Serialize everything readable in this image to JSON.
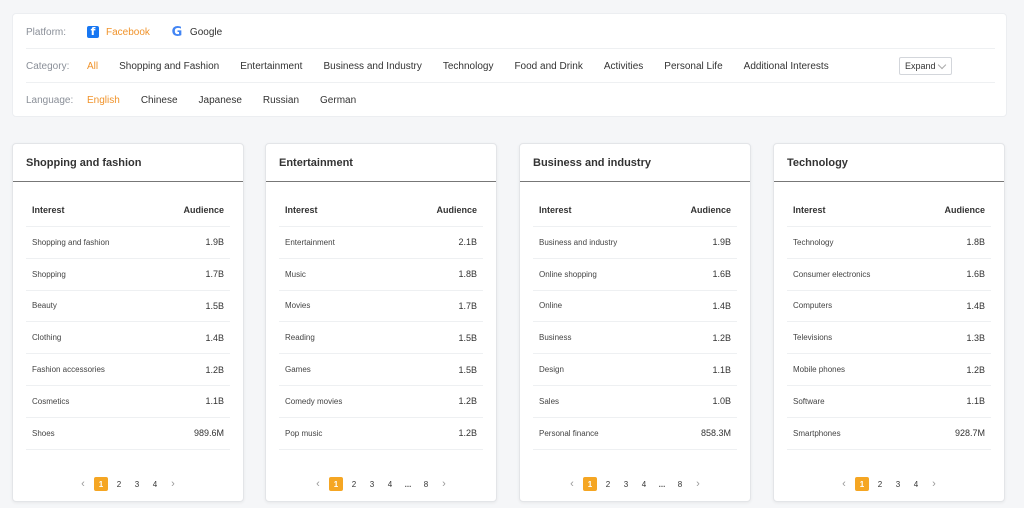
{
  "filters": {
    "platform": {
      "label": "Platform:",
      "options": [
        {
          "label": "Facebook",
          "icon": "facebook-icon",
          "active": true
        },
        {
          "label": "Google",
          "icon": "google-icon",
          "active": false
        }
      ]
    },
    "category": {
      "label": "Category:",
      "options": [
        "All",
        "Shopping and Fashion",
        "Entertainment",
        "Business and Industry",
        "Technology",
        "Food and Drink",
        "Activities",
        "Personal Life",
        "Additional Interests"
      ],
      "active": "All",
      "expand_label": "Expand"
    },
    "language": {
      "label": "Language:",
      "options": [
        "English",
        "Chinese",
        "Japanese",
        "Russian",
        "German"
      ],
      "active": "English"
    }
  },
  "accent_color": "#f0932b",
  "table_headers": {
    "interest": "Interest",
    "audience": "Audience"
  },
  "cards": [
    {
      "title": "Shopping and fashion",
      "rows": [
        {
          "interest": "Shopping and fashion",
          "audience": "1.9B"
        },
        {
          "interest": "Shopping",
          "audience": "1.7B"
        },
        {
          "interest": "Beauty",
          "audience": "1.5B"
        },
        {
          "interest": "Clothing",
          "audience": "1.4B"
        },
        {
          "interest": "Fashion accessories",
          "audience": "1.2B"
        },
        {
          "interest": "Cosmetics",
          "audience": "1.1B"
        },
        {
          "interest": "Shoes",
          "audience": "989.6M"
        }
      ],
      "pages": [
        "1",
        "2",
        "3",
        "4"
      ],
      "current_page": "1"
    },
    {
      "title": "Entertainment",
      "rows": [
        {
          "interest": "Entertainment",
          "audience": "2.1B"
        },
        {
          "interest": "Music",
          "audience": "1.8B"
        },
        {
          "interest": "Movies",
          "audience": "1.7B"
        },
        {
          "interest": "Reading",
          "audience": "1.5B"
        },
        {
          "interest": "Games",
          "audience": "1.5B"
        },
        {
          "interest": "Comedy movies",
          "audience": "1.2B"
        },
        {
          "interest": "Pop music",
          "audience": "1.2B"
        }
      ],
      "pages": [
        "1",
        "2",
        "3",
        "4",
        "...",
        "8"
      ],
      "current_page": "1"
    },
    {
      "title": "Business and industry",
      "rows": [
        {
          "interest": "Business and industry",
          "audience": "1.9B"
        },
        {
          "interest": "Online shopping",
          "audience": "1.6B"
        },
        {
          "interest": "Online",
          "audience": "1.4B"
        },
        {
          "interest": "Business",
          "audience": "1.2B"
        },
        {
          "interest": "Design",
          "audience": "1.1B"
        },
        {
          "interest": "Sales",
          "audience": "1.0B"
        },
        {
          "interest": "Personal finance",
          "audience": "858.3M"
        }
      ],
      "pages": [
        "1",
        "2",
        "3",
        "4",
        "...",
        "8"
      ],
      "current_page": "1"
    },
    {
      "title": "Technology",
      "rows": [
        {
          "interest": "Technology",
          "audience": "1.8B"
        },
        {
          "interest": "Consumer electronics",
          "audience": "1.6B"
        },
        {
          "interest": "Computers",
          "audience": "1.4B"
        },
        {
          "interest": "Televisions",
          "audience": "1.3B"
        },
        {
          "interest": "Mobile phones",
          "audience": "1.2B"
        },
        {
          "interest": "Software",
          "audience": "1.1B"
        },
        {
          "interest": "Smartphones",
          "audience": "928.7M"
        }
      ],
      "pages": [
        "1",
        "2",
        "3",
        "4"
      ],
      "current_page": "1"
    }
  ]
}
